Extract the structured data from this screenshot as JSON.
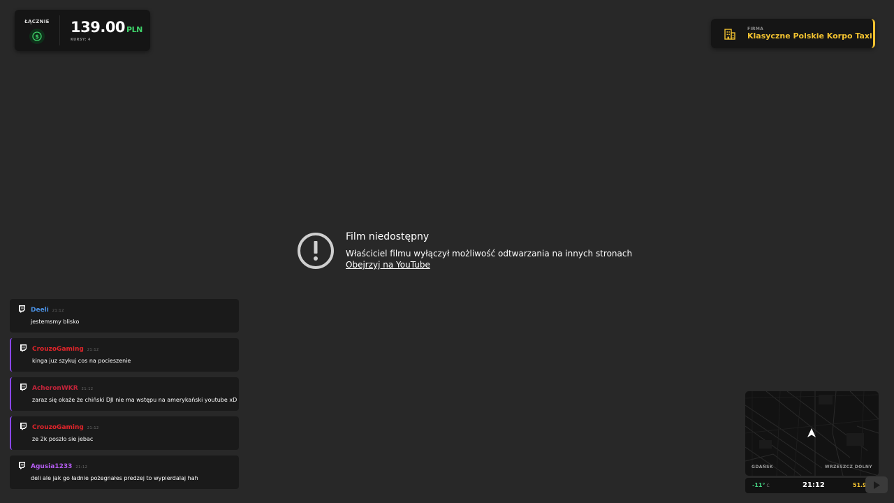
{
  "earnings": {
    "label": "ŁĄCZNIE",
    "icon": "dollar-coin-icon",
    "amount": "139.00",
    "currency": "PLN",
    "rides": "KURSY: 4"
  },
  "company": {
    "label": "FIRMA",
    "name": "Klasyczne Polskie Korpo Taxi",
    "icon": "office-building-icon",
    "accent_color": "#f2c230"
  },
  "video": {
    "title": "Film niedostępny",
    "description": "Właściciel filmu wyłączył możliwość odtwarzania na innych stronach",
    "link": "Obejrzyj na YouTube",
    "icon": "alert-circle-icon"
  },
  "chat": {
    "messages": [
      {
        "user": "Deeli",
        "time": "21:12",
        "text": "jestemsmy blisko",
        "color": "#4a90e2",
        "highlight": false
      },
      {
        "user": "CrouzoGaming",
        "time": "21:12",
        "text": "kinga juz szykuj cos na pocieszenie",
        "color": "#e0242a",
        "highlight": true
      },
      {
        "user": "AcheronWKR",
        "time": "21:12",
        "text": "zaraz się okaże że chiński DJI nie ma wstępu na amerykański youtube xD",
        "color": "#c2243a",
        "highlight": true
      },
      {
        "user": "CrouzoGaming",
        "time": "21:12",
        "text": "ze 2k poszlo sie jebac",
        "color": "#e0242a",
        "highlight": true
      },
      {
        "user": "Agusia1233",
        "time": "21:12",
        "text": "deli ale jak go ładnie pożegnałes predzej to wypierdalaj hah",
        "color": "#b45cf0",
        "highlight": false
      }
    ]
  },
  "map": {
    "city": "GDAŃSK",
    "district": "WRZESZCZ DOLNY",
    "temperature": "-11°",
    "temperature_unit": "C",
    "time": "21:12",
    "speed": "51.9"
  }
}
